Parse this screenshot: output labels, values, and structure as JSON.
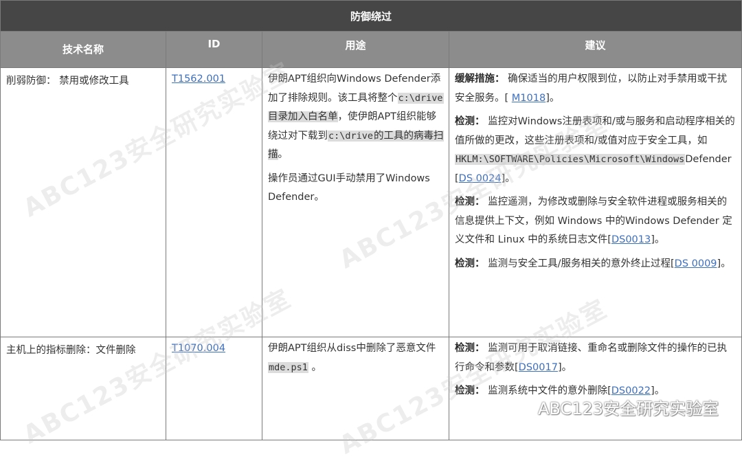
{
  "table": {
    "title": "防御绕过",
    "headers": {
      "technique": "技术名称",
      "id": "ID",
      "usage": "用途",
      "advice": "建议"
    },
    "rows": [
      {
        "technique": "削弱防御： 禁用或修改工具",
        "id": "T1562.001",
        "usage": {
          "p1_a": "伊朗APT组织向Windows Defender添加了排除规则。该工具将整个",
          "p1_code1": "c:\\drive",
          "p1_b": "目录加入白名单",
          "p1_c": "，使伊朗APT组织能够绕过对下载到",
          "p1_code2": "c:\\drive",
          "p1_d": "的工具的病毒扫描",
          "p1_e": "。",
          "p2": "操作员通过GUI手动禁用了Windows Defender。"
        },
        "advice": [
          {
            "label": "缓解措施：",
            "text": "确保适当的用户权限到位，以防止对手禁用或干扰安全服务。[ ",
            "link": "M1018",
            "tail": "]。"
          },
          {
            "label": "检测：",
            "text": "监控对Windows注册表项和/或与服务和启动程序相关的值所做的更改，这些注册表项和/或值对应于安全工具，如",
            "code": "HKLM:\\SOFTWARE\\Policies\\Microsoft\\Windows",
            "text2": "Defender [",
            "link": "DS 0024",
            "tail": "]。"
          },
          {
            "label": "检测：",
            "text": "监控遥测，为修改或删除与安全软件进程或服务相关的信息提供上下文，例如 Windows 中的Windows Defender 定义文件和 Linux 中的系统日志文件[",
            "link": "DS0013",
            "tail": "]。"
          },
          {
            "label": "检测：",
            "text": "监测与安全工具/服务相关的意外终止过程[",
            "link": "DS 0009",
            "tail": "]。"
          }
        ]
      },
      {
        "technique": "主机上的指标删除：文件删除",
        "id": "T1070.004",
        "usage": {
          "p1_a": "伊朗APT组织从diss中删除了恶意文件 ",
          "p1_code1": "mde.ps1",
          "p1_b": " 。"
        },
        "advice": [
          {
            "label": "检测：",
            "text": "监测可用于取消链接、重命名或删除文件的操作的已执行命令和参数[",
            "link": "DS0017",
            "tail": "]。"
          },
          {
            "label": "检测：",
            "text": "监测系统中文件的意外删除[",
            "link": "DS0022",
            "tail": "]。"
          }
        ]
      }
    ]
  },
  "watermark": "ABC123安全研究实验室",
  "brand": {
    "icon": "wechat-icon",
    "text": "ABC123安全研究实验室"
  },
  "colors": {
    "title_bg": "#464646",
    "header_bg": "#8c8c8c",
    "link": "#3d6fbf",
    "highlight": "#dcdcdc"
  }
}
